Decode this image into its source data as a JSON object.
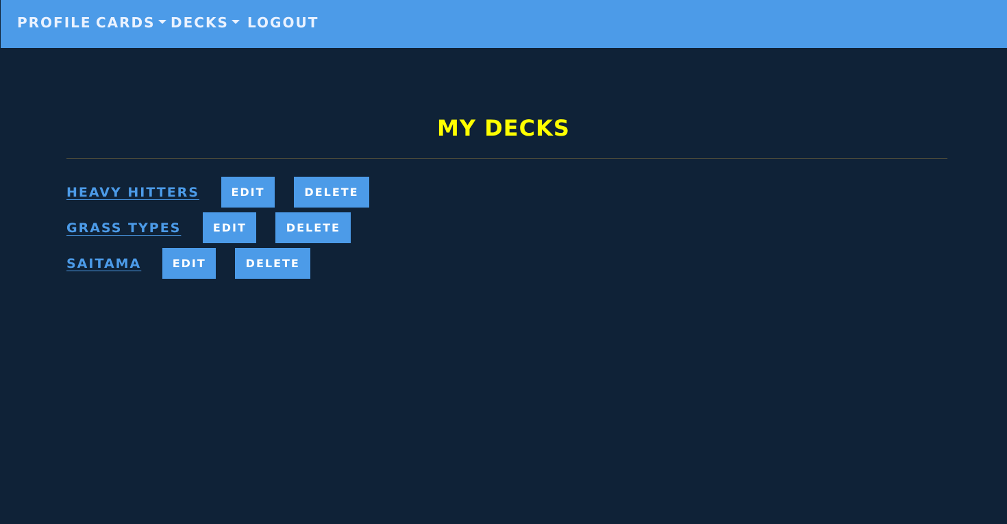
{
  "colors": {
    "navbar_bg": "#4c9be8",
    "page_bg": "#0f2237",
    "title": "#ffff00",
    "link": "#4c9be8",
    "button_bg": "#4c9be8",
    "button_text": "#ffffff"
  },
  "nav": {
    "profile": "Profile",
    "cards": "Cards",
    "decks": "Decks",
    "logout": "Logout"
  },
  "page": {
    "title": "My Decks"
  },
  "decks": [
    {
      "name": "Heavy Hitters",
      "edit_label": "Edit",
      "delete_label": "Delete"
    },
    {
      "name": "Grass Types",
      "edit_label": "Edit",
      "delete_label": "Delete"
    },
    {
      "name": "Saitama",
      "edit_label": "Edit",
      "delete_label": "Delete"
    }
  ]
}
